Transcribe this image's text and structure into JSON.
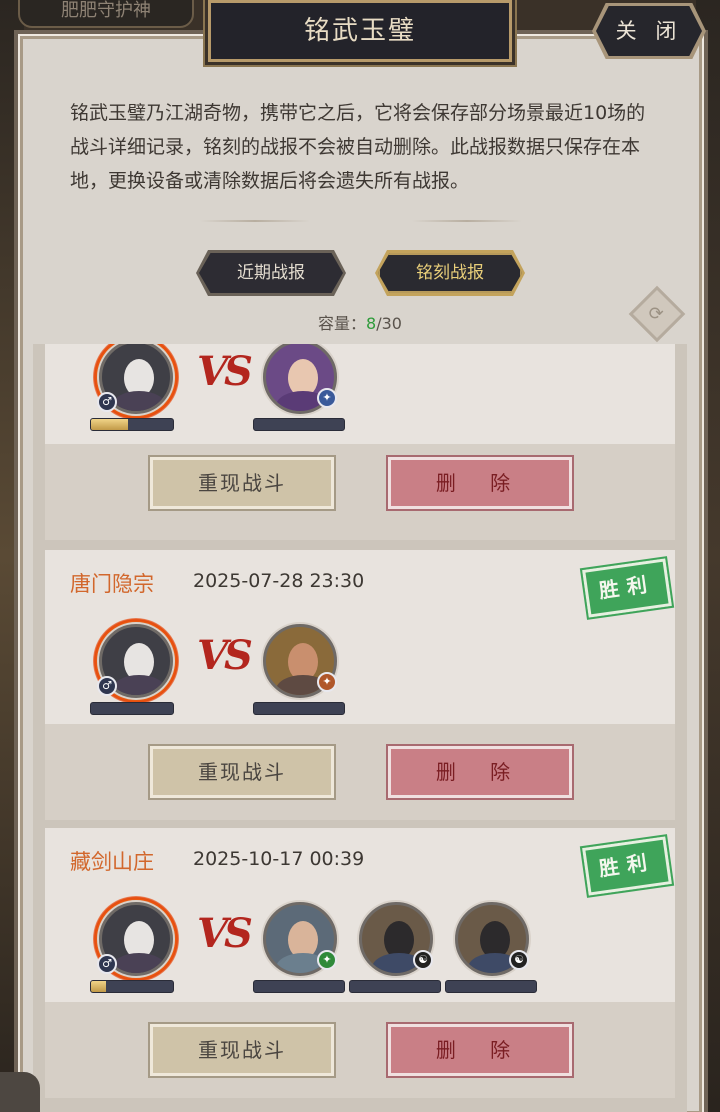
{
  "top_tab": "肥肥守护神",
  "title": "铭武玉璧",
  "close_label": "关 闭",
  "description": "铭武玉璧乃江湖奇物，携带它之后，它将会保存部分场景最近10场的战斗详细记录，铭刻的战报不会被自动删除。此战报数据只保存在本地，更换设备或清除数据后将会遗失所有战报。",
  "tabs": {
    "recent": "近期战报",
    "engraved": "铭刻战报",
    "active": "engraved"
  },
  "capacity": {
    "label": "容量：",
    "current": "8",
    "max": "/30"
  },
  "vs_text": "VS",
  "buttons": {
    "replay": "重现战斗",
    "delete": "删 除"
  },
  "colors": {
    "faction": "#d2672c",
    "win_stamp": "#3fa45a",
    "capacity_current": "#2e9b3a",
    "vs": "#b3261e"
  },
  "records": [
    {
      "faction": "",
      "datetime": "",
      "result": "",
      "player_hp": 0.45,
      "opponents": 1
    },
    {
      "faction": "唐门隐宗",
      "datetime": "2025-07-28 23:30",
      "result": "胜利",
      "player_hp": 0.0,
      "opponents": 1
    },
    {
      "faction": "藏剑山庄",
      "datetime": "2025-10-17 00:39",
      "result": "胜利",
      "player_hp": 0.18,
      "opponents": 3
    }
  ],
  "icons": [
    "close-frame-icon",
    "refresh-icon",
    "gender-male-icon",
    "flame-aura-icon"
  ]
}
